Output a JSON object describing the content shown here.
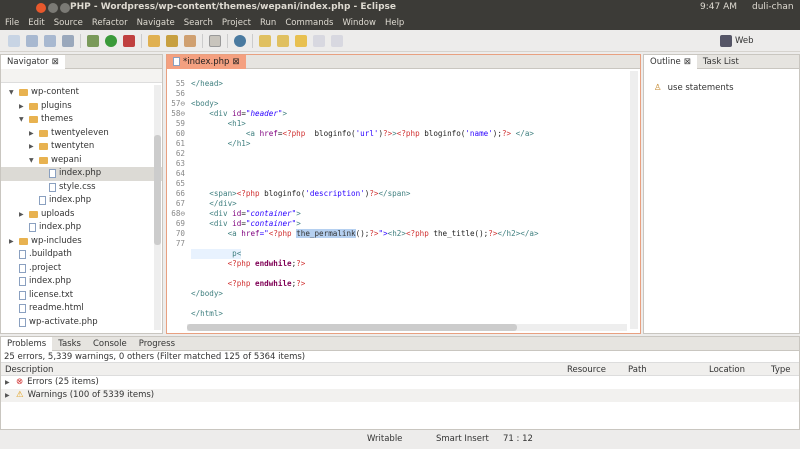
{
  "window": {
    "title": "PHP - Wordpress/wp-content/themes/wepani/index.php - Eclipse",
    "clock": "9:47 AM",
    "user": "duli-chan"
  },
  "menu": [
    "File",
    "Edit",
    "Source",
    "Refactor",
    "Navigate",
    "Search",
    "Project",
    "Run",
    "Commands",
    "Window",
    "Help"
  ],
  "perspective": {
    "label": "Web"
  },
  "navigator": {
    "title": "Navigator",
    "items": [
      {
        "label": "wp-content",
        "type": "folder",
        "depth": 0,
        "arrow": "▼"
      },
      {
        "label": "plugins",
        "type": "folder",
        "depth": 1,
        "arrow": "▶"
      },
      {
        "label": "themes",
        "type": "folder",
        "depth": 1,
        "arrow": "▼"
      },
      {
        "label": "twentyeleven",
        "type": "folder",
        "depth": 2,
        "arrow": "▶"
      },
      {
        "label": "twentyten",
        "type": "folder",
        "depth": 2,
        "arrow": "▶"
      },
      {
        "label": "wepani",
        "type": "folder",
        "depth": 2,
        "arrow": "▼"
      },
      {
        "label": "index.php",
        "type": "file",
        "depth": 3,
        "arrow": "",
        "selected": true
      },
      {
        "label": "style.css",
        "type": "file",
        "depth": 3,
        "arrow": ""
      },
      {
        "label": "index.php",
        "type": "file",
        "depth": 2,
        "arrow": ""
      },
      {
        "label": "uploads",
        "type": "folder",
        "depth": 1,
        "arrow": "▶"
      },
      {
        "label": "index.php",
        "type": "file",
        "depth": 1,
        "arrow": ""
      },
      {
        "label": "wp-includes",
        "type": "folder",
        "depth": 0,
        "arrow": "▶"
      },
      {
        "label": ".buildpath",
        "type": "file",
        "depth": 0,
        "arrow": ""
      },
      {
        "label": ".project",
        "type": "file",
        "depth": 0,
        "arrow": ""
      },
      {
        "label": "index.php",
        "type": "file",
        "depth": 0,
        "arrow": ""
      },
      {
        "label": "license.txt",
        "type": "file",
        "depth": 0,
        "arrow": ""
      },
      {
        "label": "readme.html",
        "type": "file",
        "depth": 0,
        "arrow": ""
      },
      {
        "label": "wp-activate.php",
        "type": "file",
        "depth": 0,
        "arrow": ""
      }
    ]
  },
  "editor": {
    "tab": "*index.php",
    "lines": [
      {
        "n": "55",
        "t": [
          [
            "</head>",
            "tag"
          ]
        ]
      },
      {
        "n": "56",
        "t": []
      },
      {
        "n": "57⊖",
        "t": [
          [
            "<body>",
            "tag"
          ]
        ]
      },
      {
        "n": "58⊖",
        "t": [
          [
            "    <div ",
            "tag"
          ],
          [
            "id",
            "attr"
          ],
          [
            "=",
            "fn"
          ],
          [
            "\"header\"",
            "str"
          ],
          [
            ">",
            "tag"
          ]
        ]
      },
      {
        "n": "59",
        "t": [
          [
            "        <h1>",
            "tag"
          ]
        ]
      },
      {
        "n": "60",
        "t": [
          [
            "            <a ",
            "tag"
          ],
          [
            "href",
            "attr"
          ],
          [
            "=",
            "fn"
          ],
          [
            "<?php",
            "php"
          ],
          [
            "  bloginfo(",
            "fn"
          ],
          [
            "'url'",
            "sq"
          ],
          [
            ")",
            "fn"
          ],
          [
            "?>",
            "php"
          ],
          [
            ">",
            "tag"
          ],
          [
            "<?php",
            "php"
          ],
          [
            " bloginfo(",
            "fn"
          ],
          [
            "'name'",
            "sq"
          ],
          [
            ");",
            "fn"
          ],
          [
            "?>",
            "php"
          ],
          [
            " </a>",
            "tag"
          ]
        ]
      },
      {
        "n": "61",
        "t": [
          [
            "        </h1>",
            "tag"
          ]
        ]
      },
      {
        "n": "62",
        "t": []
      },
      {
        "n": "63",
        "t": []
      },
      {
        "n": "64",
        "t": []
      },
      {
        "n": "65",
        "t": []
      },
      {
        "n": "66",
        "t": [
          [
            "    <span>",
            "tag"
          ],
          [
            "<?php",
            "php"
          ],
          [
            " bloginfo(",
            "fn"
          ],
          [
            "'description'",
            "sq"
          ],
          [
            ")",
            "fn"
          ],
          [
            "?>",
            "php"
          ],
          [
            "</span>",
            "tag"
          ]
        ]
      },
      {
        "n": "67",
        "t": [
          [
            "    </div>",
            "tag"
          ]
        ]
      },
      {
        "n": "68⊖",
        "t": [
          [
            "    <div ",
            "tag"
          ],
          [
            "id",
            "attr"
          ],
          [
            "=",
            "fn"
          ],
          [
            "\"container\"",
            "str"
          ],
          [
            ">",
            "tag"
          ]
        ]
      },
      {
        "n": "69",
        "t": [
          [
            "    <div ",
            "tag"
          ],
          [
            "id",
            "attr"
          ],
          [
            "=",
            "fn"
          ],
          [
            "\"container\"",
            "str"
          ],
          [
            ">",
            "tag"
          ]
        ]
      },
      {
        "n": "70",
        "t": [
          [
            "        <a ",
            "tag"
          ],
          [
            "href",
            "attr"
          ],
          [
            "=\"",
            "str"
          ],
          [
            "<?php",
            "php"
          ],
          [
            " ",
            "fn"
          ],
          [
            "the_permalink",
            "sel"
          ],
          [
            "();",
            "fn"
          ],
          [
            "?>",
            "php"
          ],
          [
            "\">",
            "str"
          ],
          [
            "<h2>",
            "tag"
          ],
          [
            "<?php",
            "php"
          ],
          [
            " the_title();",
            "fn"
          ],
          [
            "?>",
            "php"
          ],
          [
            "</h2></a>",
            "tag"
          ]
        ]
      },
      {
        "n": "77",
        "t": []
      },
      {
        "n": "",
        "t": [
          [
            "         p<",
            "tag"
          ]
        ]
      },
      {
        "n": "",
        "t": [
          [
            "        <?php",
            "php"
          ],
          [
            " endwhile",
            "kw"
          ],
          [
            ";",
            "fn"
          ],
          [
            "?>",
            "php"
          ]
        ]
      },
      {
        "n": "",
        "t": []
      },
      {
        "n": "",
        "t": [
          [
            "        <?php",
            "php"
          ],
          [
            " endwhile",
            "kw"
          ],
          [
            ";",
            "fn"
          ],
          [
            "?>",
            "php"
          ]
        ]
      },
      {
        "n": "",
        "t": [
          [
            "</body>",
            "tag"
          ]
        ]
      },
      {
        "n": "",
        "t": []
      },
      {
        "n": "",
        "t": [
          [
            "</html>",
            "tag"
          ]
        ]
      }
    ]
  },
  "outline": {
    "tab": "Outline",
    "tab2": "Task List",
    "items": [
      "use statements"
    ]
  },
  "problems": {
    "tabs": [
      "Problems",
      "Tasks",
      "Console",
      "Progress"
    ],
    "summary": "25 errors, 5,339 warnings, 0 others (Filter matched 125 of 5364 items)",
    "columns": [
      "Description",
      "Resource",
      "Path",
      "Location",
      "Type"
    ],
    "rows": [
      "Errors (25 items)",
      "Warnings (100 of 5339 items)"
    ]
  },
  "status": {
    "mode": "Writable",
    "insert": "Smart Insert",
    "position": "71 : 12"
  }
}
